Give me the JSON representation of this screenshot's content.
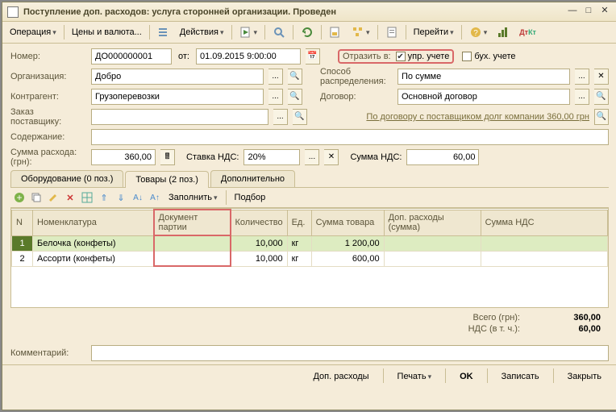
{
  "window": {
    "title": "Поступление доп. расходов: услуга сторонней организации. Проведен"
  },
  "toolbar": {
    "operation": "Операция",
    "prices": "Цены и валюта...",
    "actions": "Действия",
    "go": "Перейти"
  },
  "form": {
    "number_label": "Номер:",
    "number": "ДО000000001",
    "date_label": "от:",
    "date": "01.09.2015  9:00:00",
    "reflect_label": "Отразить в:",
    "upr": "упр. учете",
    "buh": "бух. учете",
    "org_label": "Организация:",
    "org": "Добро",
    "dist_label": "Способ распределения:",
    "dist": "По сумме",
    "contr_label": "Контрагент:",
    "contr": "Грузоперевозки",
    "dog_label": "Договор:",
    "dog": "Основной договор",
    "order_label": "Заказ поставщику:",
    "debt_link": "По договору с поставщиком долг компании 360,00 грн",
    "content_label": "Содержание:",
    "sum_label": "Сумма расхода: (грн):",
    "sum": "360,00",
    "vatrate_label": "Ставка НДС:",
    "vatrate": "20%",
    "vatsum_label": "Сумма НДС:",
    "vatsum": "60,00"
  },
  "tabs": {
    "t0": "Оборудование (0 поз.)",
    "t1": "Товары (2 поз.)",
    "t2": "Дополнительно"
  },
  "tabtool": {
    "fill": "Заполнить",
    "select": "Подбор"
  },
  "grid": {
    "cols": {
      "n": "N",
      "nom": "Номенклатура",
      "doc": "Документ партии",
      "qty": "Количество",
      "unit": "Ед.",
      "sum": "Сумма товара",
      "add": "Доп. расходы (сумма)",
      "vat": "Сумма НДС"
    },
    "rows": [
      {
        "n": "1",
        "nom": "Белочка (конфеты)",
        "doc": "",
        "qty": "10,000",
        "unit": "кг",
        "sum": "1 200,00",
        "add": "",
        "vat": ""
      },
      {
        "n": "2",
        "nom": "Ассорти (конфеты)",
        "doc": "",
        "qty": "10,000",
        "unit": "кг",
        "sum": "600,00",
        "add": "",
        "vat": ""
      }
    ]
  },
  "totals": {
    "total_label": "Всего (грн):",
    "total": "360,00",
    "vat_label": "НДС (в т. ч.):",
    "vat": "60,00"
  },
  "comment_label": "Комментарий:",
  "footer": {
    "add": "Доп. расходы",
    "print": "Печать",
    "ok": "OK",
    "save": "Записать",
    "close": "Закрыть"
  }
}
